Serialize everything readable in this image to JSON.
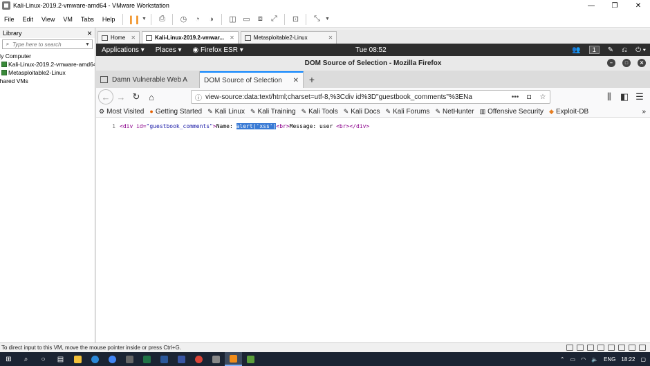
{
  "window": {
    "title": "Kali-Linux-2019.2-vmware-amd64 - VMware Workstation",
    "controls": [
      "—",
      "❐",
      "✕"
    ]
  },
  "menu": {
    "items": [
      "File",
      "Edit",
      "View",
      "VM",
      "Tabs",
      "Help"
    ]
  },
  "library": {
    "title": "Library",
    "close": "×",
    "search_placeholder": "Type here to search",
    "items": [
      "My Computer",
      "Kali-Linux-2019.2-vmware-amd64",
      "Metasploitable2-Linux",
      "Shared VMs"
    ]
  },
  "vm_tabs": [
    {
      "label": "Home",
      "active": false
    },
    {
      "label": "Kali-Linux-2019.2-vmwar...",
      "active": true
    },
    {
      "label": "Metasploitable2-Linux",
      "active": false
    }
  ],
  "kali_panel": {
    "applications": "Applications ▾",
    "places": "Places ▾",
    "firefox": "Firefox ESR ▾",
    "clock": "Tue 08:52",
    "workspace": "1"
  },
  "firefox": {
    "window_title": "DOM Source of Selection - Mozilla Firefox",
    "tabs": [
      {
        "label": "Damn Vulnerable Web A",
        "active": false
      },
      {
        "label": "DOM Source of Selection",
        "active": true
      }
    ],
    "new_tab": "+",
    "url": "view-source:data:text/html;charset=utf-8,%3Cdiv id%3D\"guestbook_comments\"%3ENa",
    "bookmarks": [
      "Most Visited",
      "Getting Started",
      "Kali Linux",
      "Kali Training",
      "Kali Tools",
      "Kali Docs",
      "Kali Forums",
      "NetHunter",
      "Offensive Security",
      "Exploit-DB"
    ],
    "source": {
      "line_number": "1",
      "open_tag_start": "<div ",
      "attr_name": "id=",
      "attr_value": "\"guestbook_comments\"",
      "open_tag_end": ">",
      "text_before": "Name: ",
      "selected_text": "alert('xss')",
      "br_tag_1": "<br>",
      "text_after": "Message: user ",
      "br_tag_2": "<br>",
      "close_tag": "</div>"
    }
  },
  "statusbar": {
    "text": "To direct input to this VM, move the mouse pointer inside or press Ctrl+G."
  },
  "taskbar": {
    "lang": "ENG",
    "time": "18:22"
  },
  "colors": {
    "selection": "#3a7bd5",
    "tag": "#8b008b",
    "attr_value": "#1a1aa6",
    "kali_panel": "#2d2d2d",
    "taskbar": "#1b2433"
  }
}
